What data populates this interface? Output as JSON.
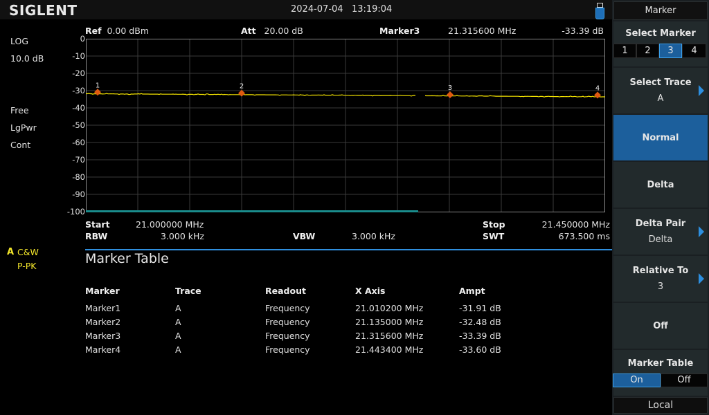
{
  "header": {
    "brand": "SIGLENT",
    "datetime": "2024-07-04   13:19:04",
    "usb_icon": "usb-drive-icon"
  },
  "measurement_bar": {
    "ref_label": "Ref",
    "ref_value": "0.00 dBm",
    "att_label": "Att",
    "att_value": "20.00 dB",
    "marker_label": "Marker3",
    "marker_freq": "21.315600 MHz",
    "marker_ampt": "-33.39 dB"
  },
  "left_panel": {
    "scale_type": "LOG",
    "scale_div": "10.0 dB",
    "trigger": "Free",
    "avg_type": "LgPwr",
    "sweep_mode": "Cont",
    "trace_letter": "A",
    "trace_mode": "C&W",
    "detector": "P-PK"
  },
  "plot": {
    "y_ticks": [
      "0",
      "-10",
      "-20",
      "-30",
      "-40",
      "-50",
      "-60",
      "-70",
      "-80",
      "-90",
      "-100"
    ],
    "y_range_db": [
      -100,
      0
    ],
    "x_range_mhz": [
      21.0,
      21.45
    ],
    "trace_color": "#f5e400",
    "marker_color": "#e05a10",
    "trace_level_start_db": -31.8,
    "trace_level_end_db": -33.6,
    "markers": [
      {
        "label": "1",
        "freq_mhz": 21.0102,
        "ampt_db": -31.91
      },
      {
        "label": "2",
        "freq_mhz": 21.135,
        "ampt_db": -32.48
      },
      {
        "label": "3",
        "freq_mhz": 21.3156,
        "ampt_db": -33.39
      },
      {
        "label": "4",
        "freq_mhz": 21.4434,
        "ampt_db": -33.6
      }
    ],
    "sweep_progress": 0.64
  },
  "footer": {
    "start_label": "Start",
    "start_value": "21.000000 MHz",
    "stop_label": "Stop",
    "stop_value": "21.450000 MHz",
    "rbw_label": "RBW",
    "rbw_value": "3.000 kHz",
    "vbw_label": "VBW",
    "vbw_value": "3.000 kHz",
    "swt_label": "SWT",
    "swt_value": "673.500 ms"
  },
  "marker_table": {
    "title": "Marker Table",
    "columns": [
      "Marker",
      "Trace",
      "Readout",
      "X Axis",
      "Ampt"
    ],
    "rows": [
      [
        "Marker1",
        "A",
        "Frequency",
        "21.010200 MHz",
        "-31.91 dB"
      ],
      [
        "Marker2",
        "A",
        "Frequency",
        "21.135000 MHz",
        "-32.48 dB"
      ],
      [
        "Marker3",
        "A",
        "Frequency",
        "21.315600 MHz",
        "-33.39 dB"
      ],
      [
        "Marker4",
        "A",
        "Frequency",
        "21.443400 MHz",
        "-33.60 dB"
      ]
    ]
  },
  "softkeys": {
    "menu_title": "Marker",
    "select_marker": {
      "label": "Select Marker",
      "options": [
        "1",
        "2",
        "3",
        "4"
      ],
      "selected": "3"
    },
    "select_trace": {
      "label": "Select Trace",
      "value": "A"
    },
    "normal": {
      "label": "Normal"
    },
    "delta": {
      "label": "Delta"
    },
    "delta_pair": {
      "label": "Delta Pair",
      "value": "Delta"
    },
    "relative_to": {
      "label": "Relative To",
      "value": "3"
    },
    "off": {
      "label": "Off"
    },
    "marker_table": {
      "label": "Marker Table",
      "options": [
        "On",
        "Off"
      ],
      "selected": "On"
    },
    "local": "Local",
    "accent_color": "#1c5f9c"
  }
}
